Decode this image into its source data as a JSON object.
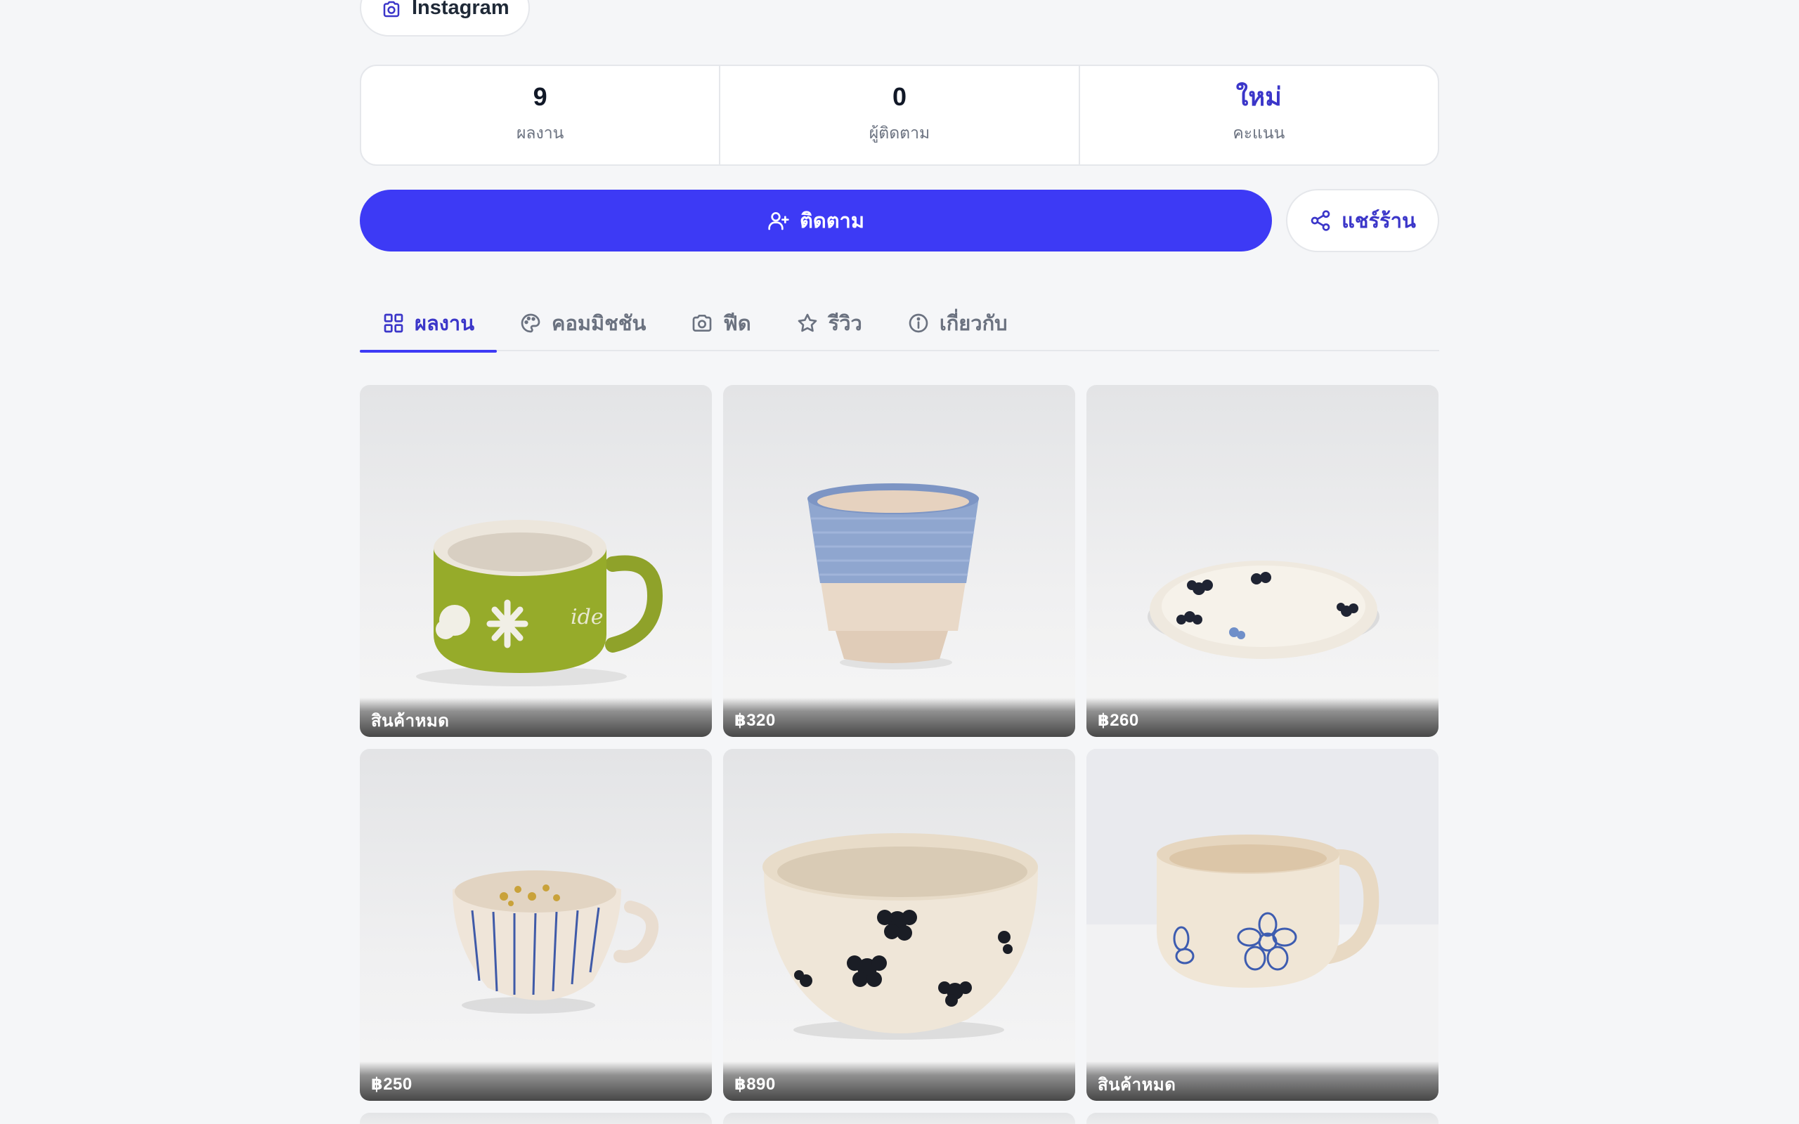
{
  "social": {
    "instagram_label": "Instagram"
  },
  "stats": [
    {
      "value": "9",
      "caption": "ผลงาน"
    },
    {
      "value": "0",
      "caption": "ผู้ติดตาม"
    },
    {
      "value": "ใหม่",
      "caption": "คะแนน"
    }
  ],
  "actions": {
    "follow_label": "ติดตาม",
    "share_label": "แชร์ร้าน"
  },
  "tabs": [
    {
      "label": "ผลงาน",
      "icon": "grid-icon",
      "active": true
    },
    {
      "label": "คอมมิชชัน",
      "icon": "palette-icon",
      "active": false
    },
    {
      "label": "ฟีด",
      "icon": "camera-icon",
      "active": false
    },
    {
      "label": "รีวิว",
      "icon": "star-icon",
      "active": false
    },
    {
      "label": "เกี่ยวกับ",
      "icon": "info-icon",
      "active": false
    }
  ],
  "products": [
    {
      "price": "สินค้าหมด",
      "image": "green mug with white flower pattern"
    },
    {
      "price": "฿320",
      "image": "blue glazed cup"
    },
    {
      "price": "฿260",
      "image": "cream plate with black flowers"
    },
    {
      "price": "฿250",
      "image": "striped trinket dish with gold rings"
    },
    {
      "price": "฿890",
      "image": "cream bowl with black flowers"
    },
    {
      "price": "สินค้าหมด",
      "image": "cream mug with blue flower outlines"
    }
  ],
  "colors": {
    "accent": "#3d3af5",
    "accent_text": "#3b36c9",
    "background": "#f5f6f8"
  }
}
